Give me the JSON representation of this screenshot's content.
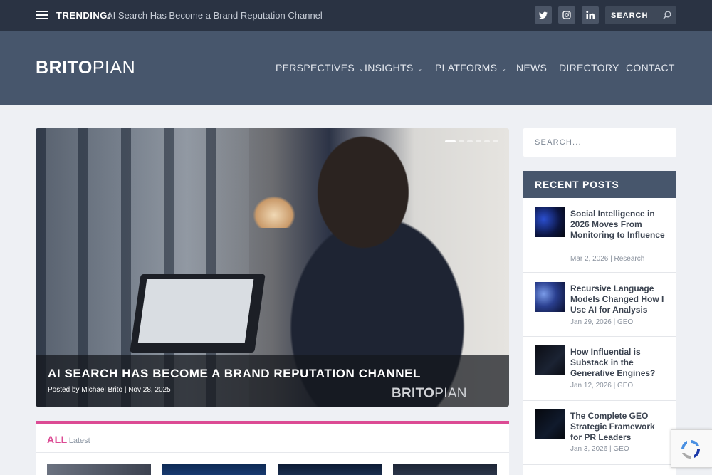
{
  "topbar": {
    "trending_label": "TRENDING:",
    "trending_text": "AI Search Has Become a Brand Reputation Channel",
    "social_icons": [
      "twitter-icon",
      "instagram-icon",
      "linkedin-icon"
    ],
    "search_placeholder": "SEARCH"
  },
  "header": {
    "logo_bold": "BRITO",
    "logo_light": "PIAN",
    "nav": [
      {
        "label": "PERSPECTIVES",
        "has_dropdown": true
      },
      {
        "label": "INSIGHTS",
        "has_dropdown": true
      },
      {
        "label": "PLATFORMS",
        "has_dropdown": true
      },
      {
        "label": "NEWS",
        "has_dropdown": false
      },
      {
        "label": "DIRECTORY",
        "has_dropdown": false
      },
      {
        "label": "CONTACT",
        "has_dropdown": false
      }
    ]
  },
  "featured": {
    "title": "AI SEARCH HAS BECOME A BRAND REPUTATION CHANNEL",
    "meta": "Posted by Michael Brito | Nov 28, 2025",
    "watermark_bold": "BRITO",
    "watermark_light": "PIAN",
    "slides_count": 6,
    "active_slide": 1
  },
  "all_section": {
    "label": "ALL",
    "sublabel": "Latest"
  },
  "sidebar": {
    "search_placeholder": "SEARCH...",
    "recent_title": "RECENT POSTS",
    "posts": [
      {
        "title": "Social Intelligence in 2026 Moves From Monitoring to Influence",
        "meta": "Mar 2, 2026 | Research"
      },
      {
        "title": "Recursive Language Models Changed How I Use AI for Analysis",
        "meta": "Jan 29, 2026 | GEO"
      },
      {
        "title": "How Influential is Substack in the Generative Engines?",
        "meta": "Jan 12, 2026 | GEO"
      },
      {
        "title": "The Complete GEO Strategic Framework for PR Leaders",
        "meta": "Jan 3, 2026 | GEO"
      }
    ]
  },
  "colors": {
    "topbar_bg": "#2a3343",
    "header_bg": "#47566c",
    "page_bg": "#eef0f4",
    "accent_pink": "#dc4b94"
  }
}
